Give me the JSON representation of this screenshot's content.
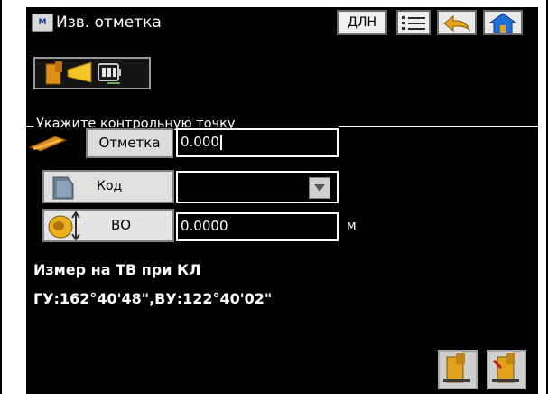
{
  "titlebar": {
    "app_icon_text": "M",
    "title": "Изв. отметка",
    "dln_label": "ДЛН"
  },
  "group": {
    "label": "Укажите контрольную точку"
  },
  "fields": {
    "elevation": {
      "button": "Отметка",
      "value": "0.000"
    },
    "code": {
      "button": "Код",
      "value": ""
    },
    "bs": {
      "button": "ВО",
      "value": "0.0000",
      "unit": "м"
    }
  },
  "status": {
    "line1": "Измер на ТВ при КЛ",
    "line2": "ГУ:162°40'48\",ВУ:122°40'02\""
  },
  "icons": {
    "app": "app-icon",
    "list": "list-icon",
    "back": "back-arrow-icon",
    "home": "home-icon",
    "mode": "prism-mode-icon",
    "elevation": "level-rod-icon",
    "code": "code-icon",
    "bs": "backsight-icon",
    "measure": "measure-icon",
    "measure_store": "measure-store-icon"
  },
  "colors": {
    "background": "#000000",
    "accent_orange": "#e08a18",
    "accent_gold": "#f0c020"
  }
}
